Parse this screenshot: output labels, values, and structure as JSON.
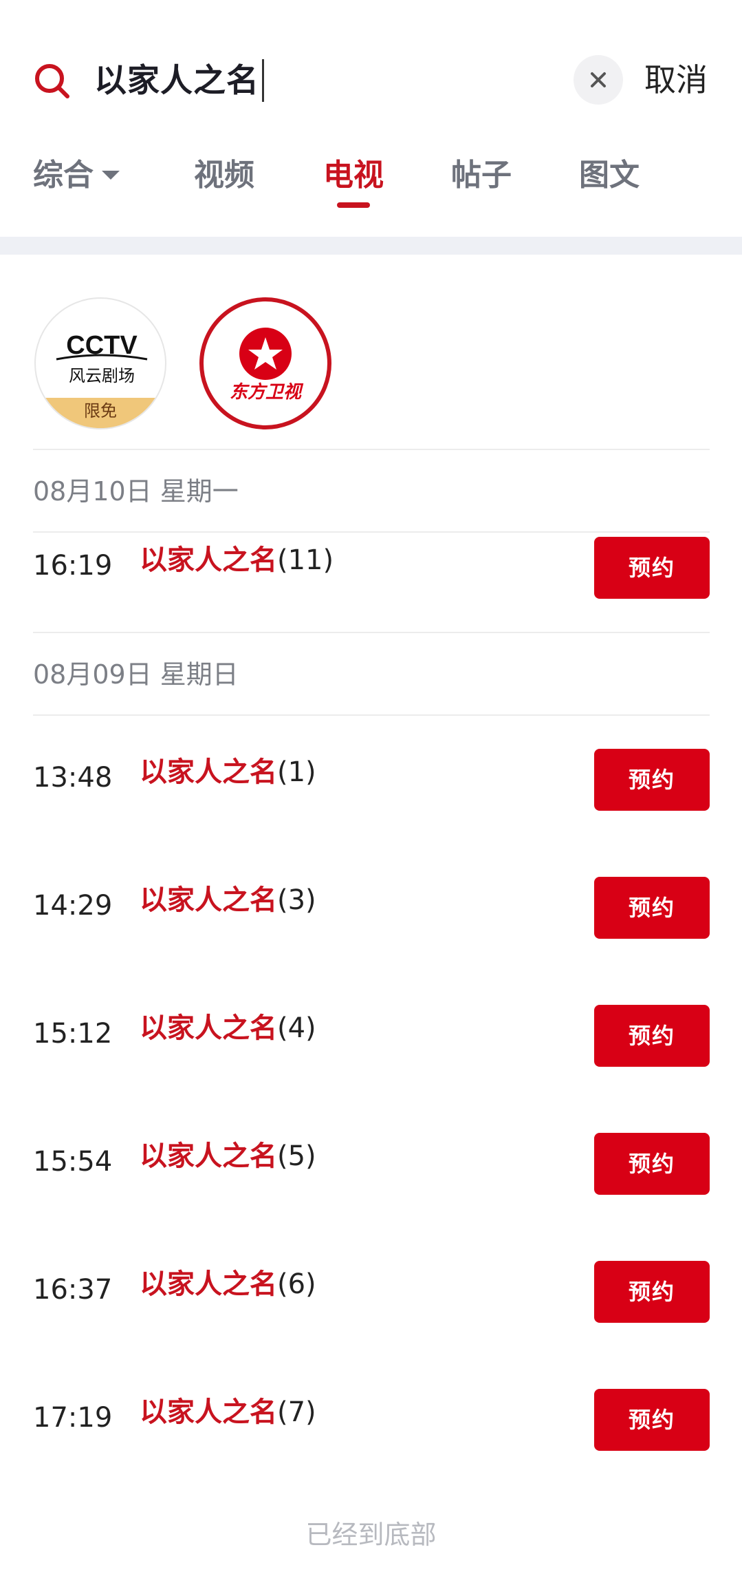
{
  "search": {
    "query": "以家人之名",
    "cancel_label": "取消"
  },
  "tabs": [
    {
      "label": "综合"
    },
    {
      "label": "视频"
    },
    {
      "label": "电视"
    },
    {
      "label": "帖子"
    },
    {
      "label": "图文"
    }
  ],
  "active_tab": "电视",
  "channels": [
    {
      "logo_text": "CCTV",
      "subtitle": "风云剧场",
      "badge": "限免"
    },
    {
      "logo_text": "东方卫视"
    }
  ],
  "schedule": [
    {
      "date": "08月10日 星期一",
      "items": [
        {
          "time": "16:19",
          "title": "以家人之名",
          "episode": "(11)",
          "button": "预约"
        }
      ]
    },
    {
      "date": "08月09日 星期日",
      "items": [
        {
          "time": "13:48",
          "title": "以家人之名",
          "episode": "(1)",
          "button": "预约"
        },
        {
          "time": "14:29",
          "title": "以家人之名",
          "episode": "(3)",
          "button": "预约"
        },
        {
          "time": "15:12",
          "title": "以家人之名",
          "episode": "(4)",
          "button": "预约"
        },
        {
          "time": "15:54",
          "title": "以家人之名",
          "episode": "(5)",
          "button": "预约"
        },
        {
          "time": "16:37",
          "title": "以家人之名",
          "episode": "(6)",
          "button": "预约"
        },
        {
          "time": "17:19",
          "title": "以家人之名",
          "episode": "(7)",
          "button": "预约"
        }
      ]
    }
  ],
  "footer_text": "已经到底部",
  "colors": {
    "accent": "#c8131f",
    "button": "#d80015",
    "muted": "#7c7f86",
    "badge": "#f0c77a"
  }
}
